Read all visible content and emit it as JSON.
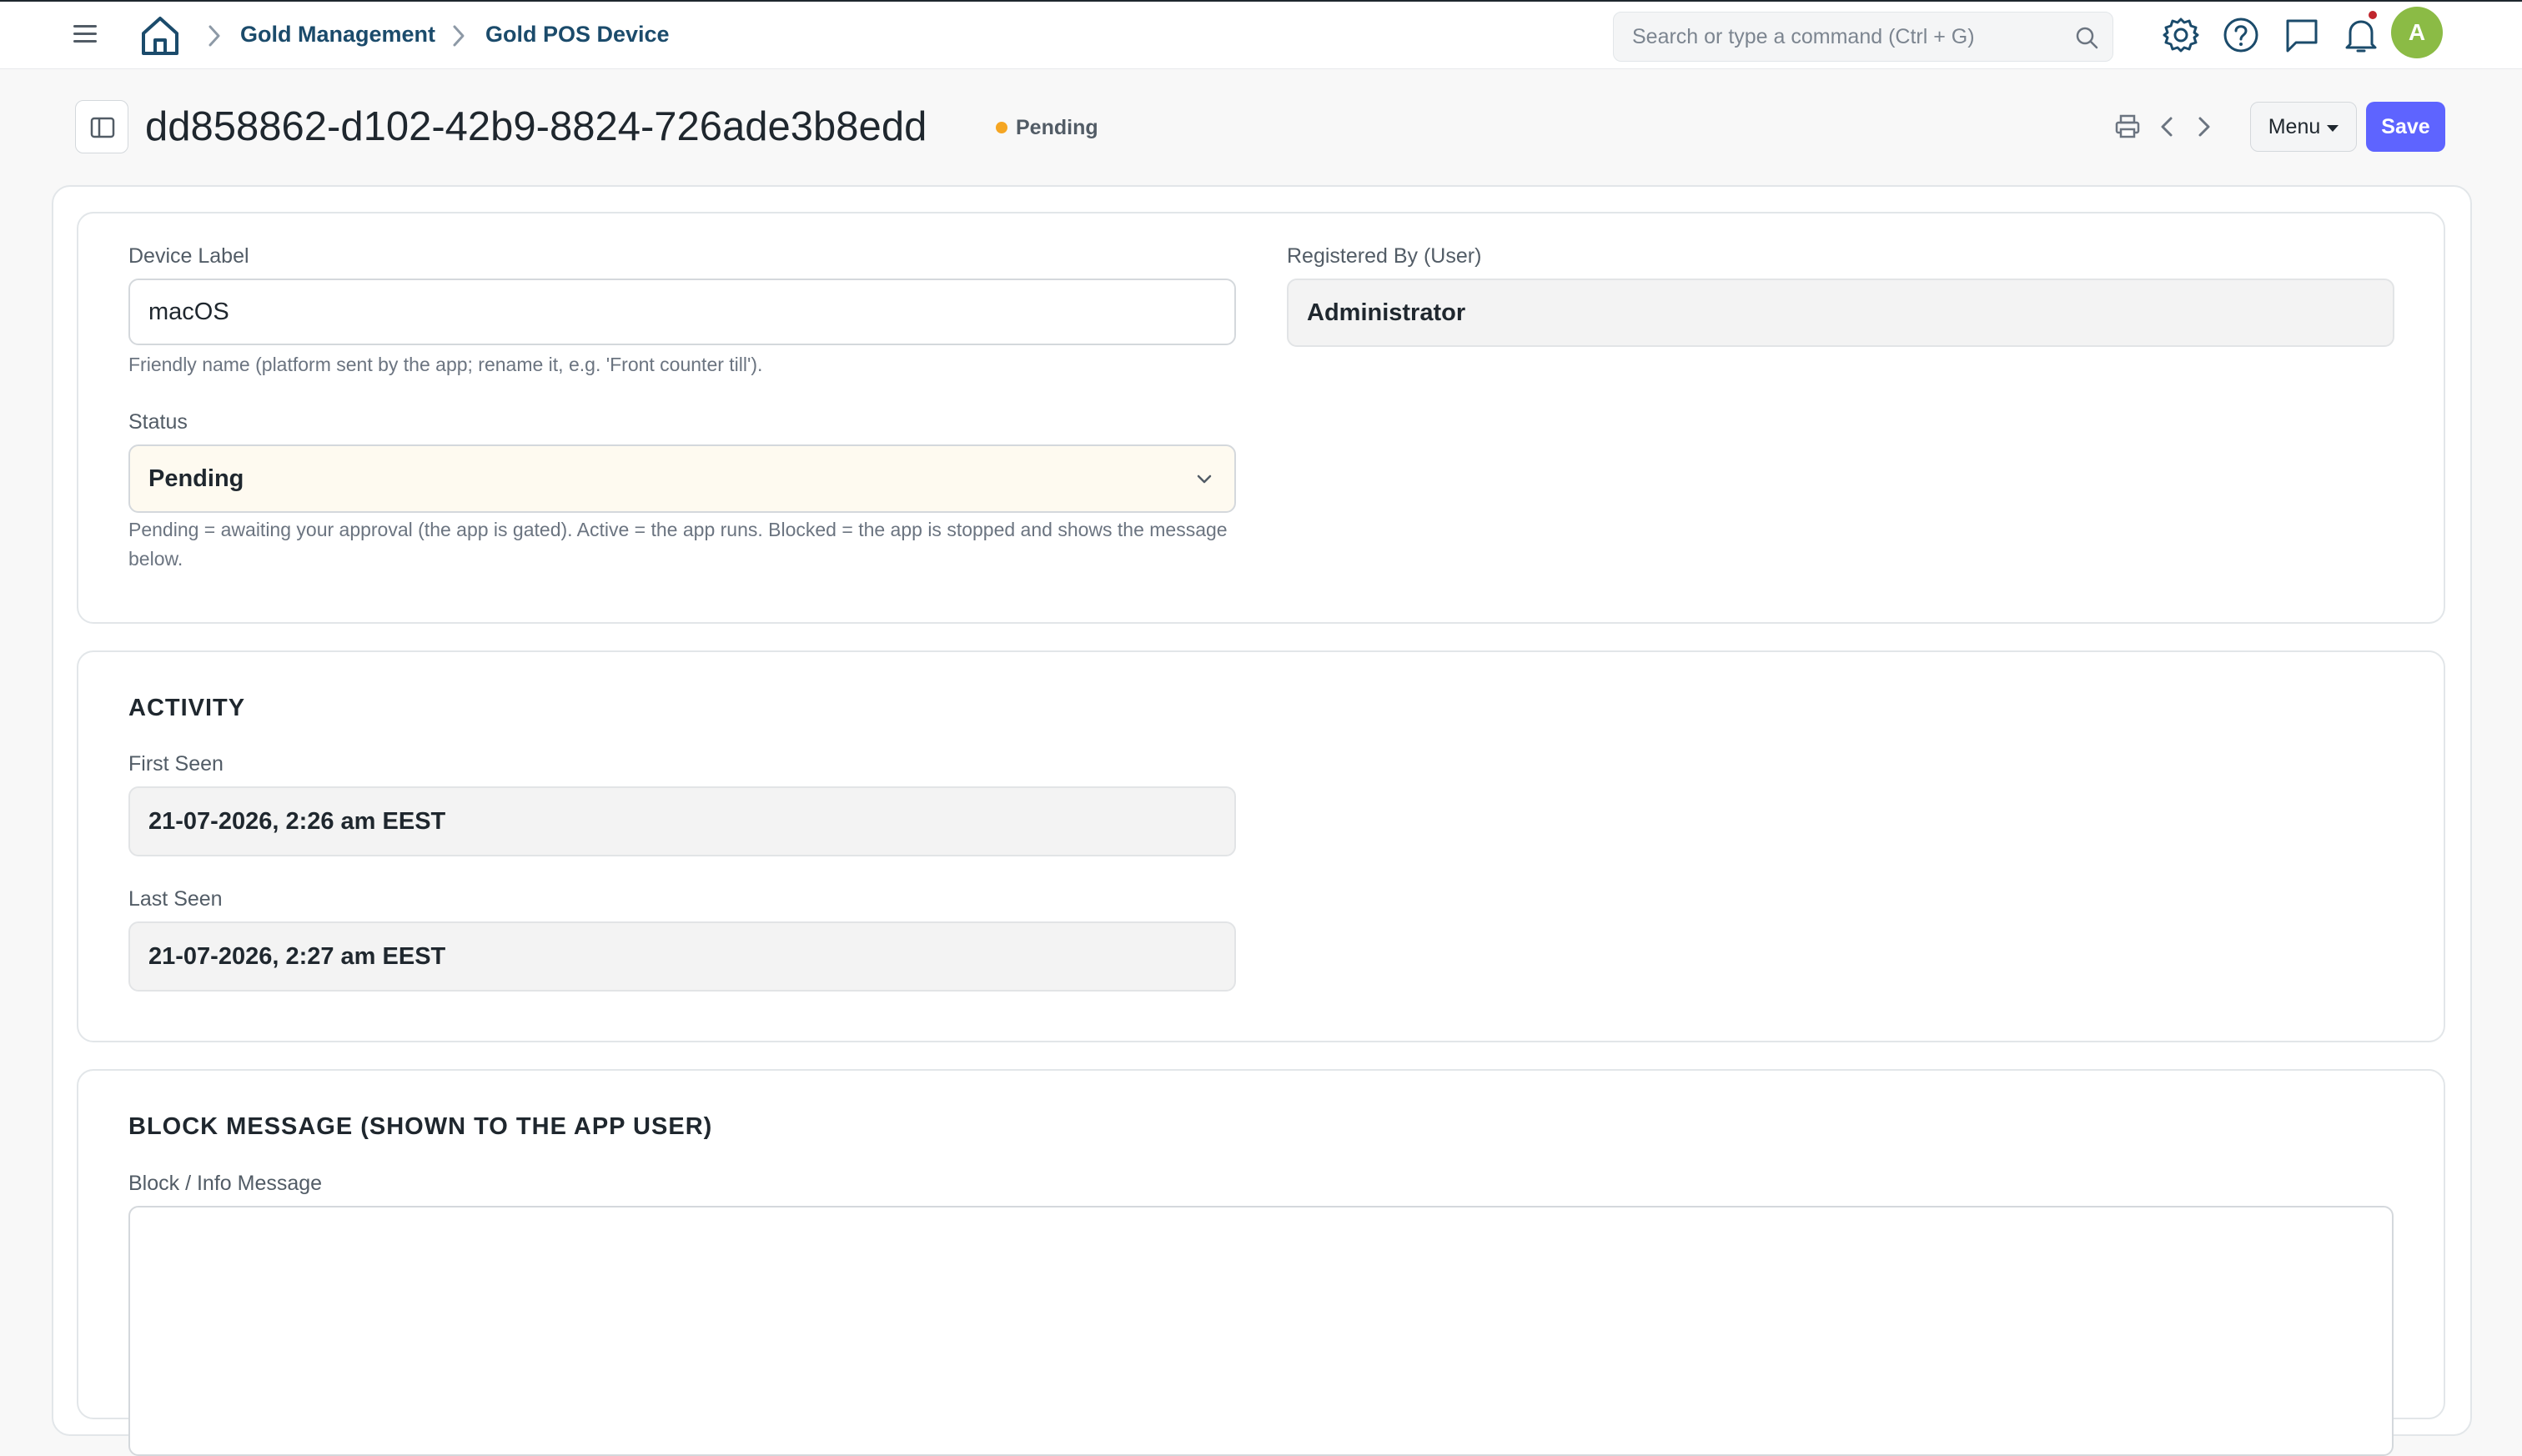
{
  "navbar": {
    "breadcrumbs": [
      "Gold Management",
      "Gold POS Device"
    ],
    "search_placeholder": "Search or type a command (Ctrl + G)",
    "avatar_initial": "A"
  },
  "page": {
    "title": "dd858862-d102-42b9-8824-726ade3b8edd",
    "status": "Pending",
    "status_color": "#f5a623",
    "menu_label": "Menu",
    "save_label": "Save"
  },
  "form": {
    "device_label": {
      "label": "Device Label",
      "value": "macOS",
      "description": "Friendly name (platform sent by the app; rename it, e.g. 'Front counter till')."
    },
    "registered_by": {
      "label": "Registered By (User)",
      "value": "Administrator"
    },
    "status": {
      "label": "Status",
      "value": "Pending",
      "description": "Pending = awaiting your approval (the app is gated). Active = the app runs. Blocked = the app is stopped and shows the message below."
    },
    "activity": {
      "heading": "ACTIVITY",
      "first_seen_label": "First Seen",
      "first_seen_value": "21-07-2026, 2:26 am EEST",
      "last_seen_label": "Last Seen",
      "last_seen_value": "21-07-2026, 2:27 am EEST"
    },
    "block": {
      "heading": "BLOCK MESSAGE (SHOWN TO THE APP USER)",
      "message_label": "Block / Info Message",
      "message_value": ""
    }
  },
  "colors": {
    "primary": "#5e64ff",
    "avatar": "#8bbb45",
    "notification_dot": "#c0262d",
    "breadcrumb": "#1b4b6b"
  }
}
